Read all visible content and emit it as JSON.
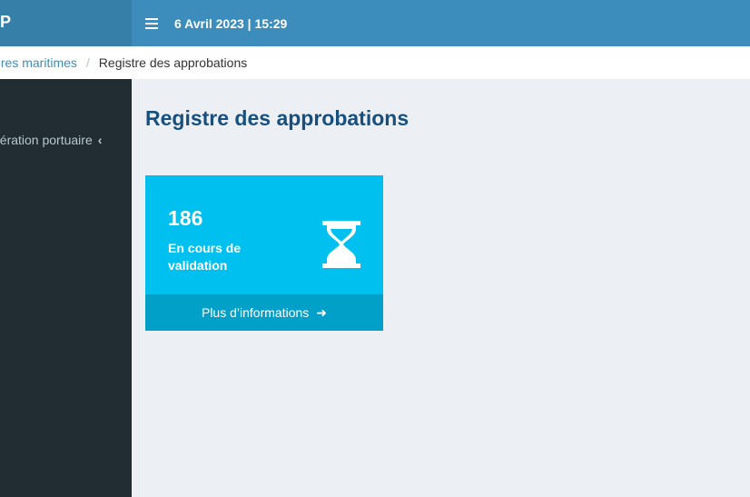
{
  "header": {
    "logo_fragment": "P",
    "datetime": "6 Avril 2023 | 15:29"
  },
  "breadcrumb": {
    "parent": "aires maritimes",
    "separator": "/",
    "current": "Registre des approbations"
  },
  "sidebar": {
    "items": [
      {
        "label": "pération portuaire",
        "chevron": "‹"
      }
    ]
  },
  "main": {
    "title": "Registre des approbations",
    "info_box": {
      "count": "186",
      "description": "En cours de validation",
      "icon": "hourglass-icon",
      "footer_label": "Plus d’informations",
      "footer_arrow": "➜",
      "bg_color": "#00c0ef",
      "footer_color": "#00a0c8"
    }
  },
  "colors": {
    "navbar": "#3c8dbc",
    "sidebar": "#222d32",
    "content_bg": "#ecf0f5",
    "title": "#17507e"
  }
}
